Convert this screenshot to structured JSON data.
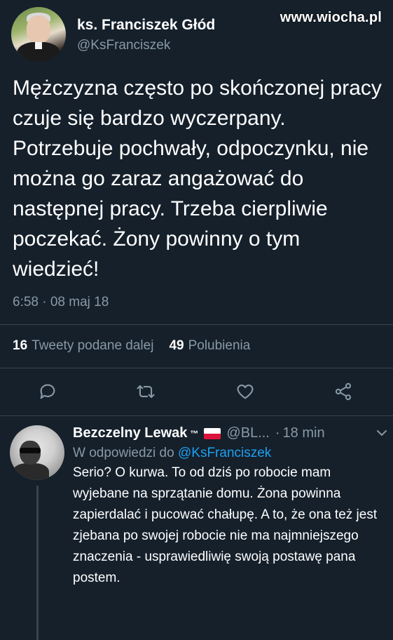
{
  "watermark": "www.wiocha.pl",
  "tweet": {
    "display_name": "ks. Franciszek Głód",
    "handle": "@KsFranciszek",
    "text": "Mężczyzna często po skończonej pracy czuje się bardzo wyczerpany. Potrzebuje pochwały, odpoczynku, nie można go zaraz angażować do następnej pracy. Trzeba cierpliwie poczekać. Żony powinny o tym wiedzieć!",
    "time": "6:58 · 08 maj 18",
    "retweets_count": "16",
    "retweets_label": "Tweety podane dalej",
    "likes_count": "49",
    "likes_label": "Polubienia",
    "actions": [
      {
        "icon": "reply-icon"
      },
      {
        "icon": "retweet-icon"
      },
      {
        "icon": "like-icon"
      },
      {
        "icon": "share-icon"
      }
    ]
  },
  "reply": {
    "display_name": "Bezczelny Lewak",
    "tm": "™",
    "flag": "poland-flag-icon",
    "handle": "@BL...",
    "dot": "·",
    "time": "18 min",
    "reply_to_prefix": "W odpowiedzi do",
    "reply_to_handle": "@KsFranciszek",
    "text": "Serio? O kurwa. To od dziś po robocie mam wyjebane na sprzątanie domu. Żona powinna zapierdalać i pucować chałupę. A to, że ona też jest zjebana po swojej robocie nie ma najmniejszego znaczenia - usprawiedliwię swoją postawę pana postem."
  },
  "colors": {
    "background": "#15202b",
    "secondary_text": "#8899a6",
    "divider": "#38444d",
    "mention": "#1da1f2"
  }
}
